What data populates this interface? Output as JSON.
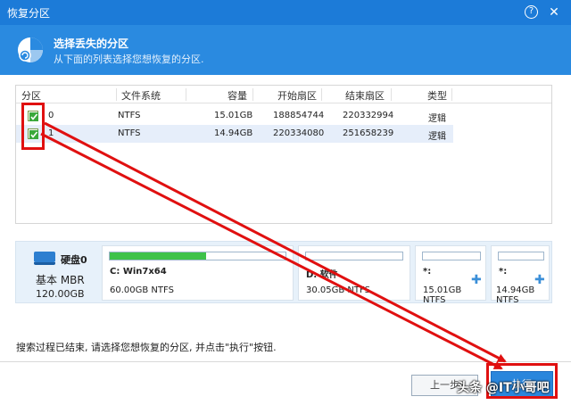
{
  "window": {
    "title": "恢复分区",
    "help_label": "?",
    "close_label": "✕"
  },
  "header": {
    "title": "选择丢失的分区",
    "subtitle": "从下面的列表选择您想恢复的分区."
  },
  "table": {
    "headers": [
      "分区",
      "文件系统",
      "容量",
      "开始扇区",
      "结束扇区",
      "类型"
    ],
    "rows": [
      {
        "checked": true,
        "partition": "0",
        "fs": "NTFS",
        "size": "15.01GB",
        "start": "188854744",
        "end": "220332994",
        "type": "逻辑"
      },
      {
        "checked": true,
        "partition": "1",
        "fs": "NTFS",
        "size": "14.94GB",
        "start": "220334080",
        "end": "251658239",
        "type": "逻辑"
      }
    ]
  },
  "disk": {
    "name": "硬盘0",
    "type": "基本 MBR",
    "size": "120.00GB",
    "partitions": [
      {
        "label": "C: Win7x64",
        "size": "60.00GB NTFS",
        "usage": 0.55,
        "plus": ""
      },
      {
        "label": "D: 软件",
        "size": "30.05GB NTFS",
        "usage": 0.0,
        "plus": ""
      },
      {
        "label": "*:",
        "size": "15.01GB NTFS",
        "usage": 0.0,
        "plus": "✚"
      },
      {
        "label": "*:",
        "size": "14.94GB NTFS",
        "usage": 0.0,
        "plus": "✚"
      }
    ]
  },
  "status_text": "搜索过程已结束, 请选择您想恢复的分区, 并点击\"执行\"按钮.",
  "buttons": {
    "prev": "上一步",
    "exec": "执行"
  },
  "watermark": "头条 @IT小哥吧",
  "colors": {
    "titlebar": "#1c7bd8",
    "header": "#2a8ae0",
    "annotation": "#e01010",
    "usage_fill": "#3ec24a"
  }
}
